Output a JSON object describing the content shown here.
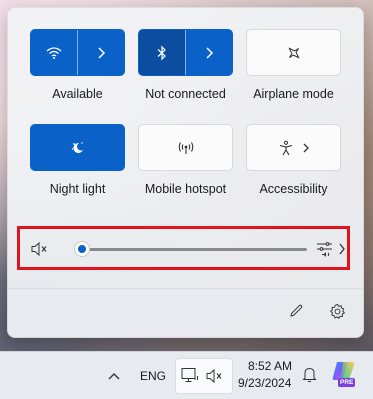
{
  "quick_settings": {
    "tiles": [
      {
        "label": "Available",
        "icon": "wifi-icon",
        "state": "on"
      },
      {
        "label": "Not connected",
        "icon": "bluetooth-icon",
        "state": "on"
      },
      {
        "label": "Airplane mode",
        "icon": "airplane-icon",
        "state": "off"
      },
      {
        "label": "Night light",
        "icon": "night-light-icon",
        "state": "on"
      },
      {
        "label": "Mobile hotspot",
        "icon": "hotspot-icon",
        "state": "off"
      },
      {
        "label": "Accessibility",
        "icon": "accessibility-icon",
        "state": "off"
      }
    ],
    "volume": {
      "level_percent": 0,
      "muted": true
    },
    "highlight_color": "#e0141c",
    "accent_color": "#0a62c9"
  },
  "taskbar": {
    "language": "ENG",
    "time": "8:52 AM",
    "date": "9/23/2024",
    "copilot_badge": "PRE"
  }
}
